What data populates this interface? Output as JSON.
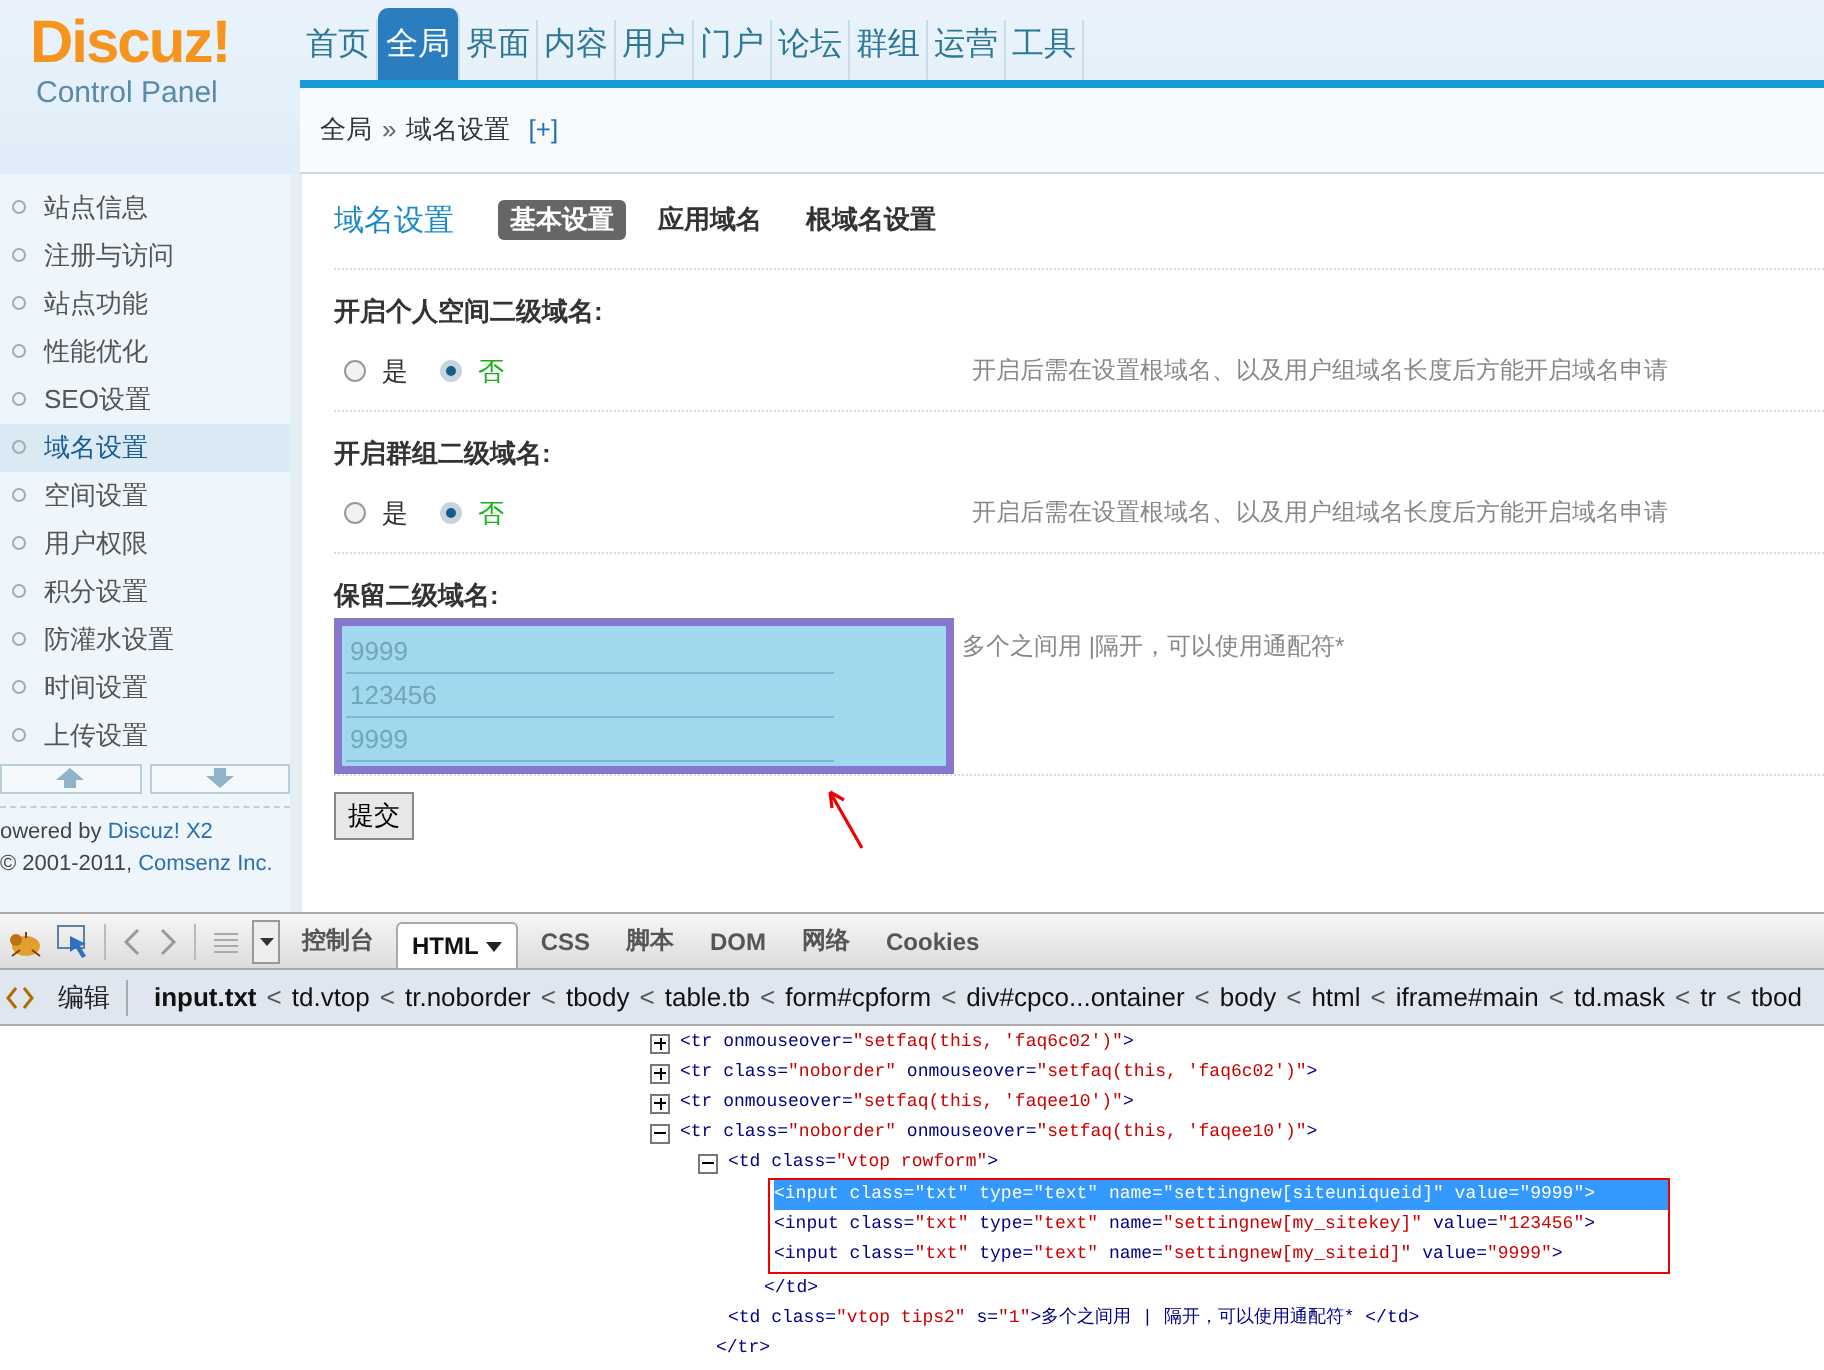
{
  "logo": {
    "title": "Discuz!",
    "subtitle": "Control Panel"
  },
  "nav": [
    {
      "label": "首页",
      "selected": false
    },
    {
      "label": "全局",
      "selected": true
    },
    {
      "label": "界面",
      "selected": false
    },
    {
      "label": "内容",
      "selected": false
    },
    {
      "label": "用户",
      "selected": false
    },
    {
      "label": "门户",
      "selected": false
    },
    {
      "label": "论坛",
      "selected": false
    },
    {
      "label": "群组",
      "selected": false
    },
    {
      "label": "运营",
      "selected": false
    },
    {
      "label": "工具",
      "selected": false
    }
  ],
  "breadcrumb": {
    "items": [
      "全局",
      "域名设置"
    ],
    "separator": "»",
    "add": "[+]"
  },
  "sidebar": {
    "items": [
      {
        "label": "站点信息",
        "selected": false
      },
      {
        "label": "注册与访问",
        "selected": false
      },
      {
        "label": "站点功能",
        "selected": false
      },
      {
        "label": "性能优化",
        "selected": false
      },
      {
        "label": "SEO设置",
        "selected": false
      },
      {
        "label": "域名设置",
        "selected": true
      },
      {
        "label": "空间设置",
        "selected": false
      },
      {
        "label": "用户权限",
        "selected": false
      },
      {
        "label": "积分设置",
        "selected": false
      },
      {
        "label": "防灌水设置",
        "selected": false
      },
      {
        "label": "时间设置",
        "selected": false
      },
      {
        "label": "上传设置",
        "selected": false
      }
    ],
    "powered": {
      "text": "owered by",
      "link": "Discuz! X2"
    },
    "copyright": {
      "text": "© 2001-2011,",
      "link": "Comsenz Inc."
    }
  },
  "main": {
    "title": "域名设置",
    "tabs": [
      {
        "label": "基本设置",
        "selected": true
      },
      {
        "label": "应用域名",
        "selected": false
      },
      {
        "label": "根域名设置",
        "selected": false
      }
    ],
    "settings": [
      {
        "kind": "radio",
        "label": "开启个人空间二级域名:",
        "options": [
          {
            "label": "是",
            "selected": false
          },
          {
            "label": "否",
            "selected": true
          }
        ],
        "tip": "开启后需在设置根域名、以及用户组域名长度后方能开启域名申请"
      },
      {
        "kind": "radio",
        "label": "开启群组二级域名:",
        "options": [
          {
            "label": "是",
            "selected": false
          },
          {
            "label": "否",
            "selected": true
          }
        ],
        "tip": "开启后需在设置根域名、以及用户组域名长度后方能开启域名申请"
      },
      {
        "kind": "inputs",
        "label": "保留二级域名:",
        "values": [
          "9999",
          "123456",
          "9999"
        ],
        "tip": "多个之间用 |隔开，可以使用通配符*"
      }
    ],
    "submit": "提交"
  },
  "devtools": {
    "tabs": [
      {
        "label": "控制台",
        "selected": false
      },
      {
        "label": "HTML",
        "selected": true
      },
      {
        "label": "CSS",
        "selected": false
      },
      {
        "label": "脚本",
        "selected": false
      },
      {
        "label": "DOM",
        "selected": false
      },
      {
        "label": "网络",
        "selected": false
      },
      {
        "label": "Cookies",
        "selected": false
      }
    ],
    "edit": "编辑",
    "separator": "<",
    "path": [
      "input.txt",
      "td.vtop",
      "tr.noborder",
      "tbody",
      "table.tb",
      "form#cpform",
      "div#cpco...ontainer",
      "body",
      "html",
      "iframe#main",
      "td.mask",
      "tr",
      "tbod"
    ],
    "tree": [
      {
        "text": "<tr onmouseover=\"setfaq(this, 'faq6c02')\">",
        "expanded": false
      },
      {
        "text": "<tr class=\"noborder\" onmouseover=\"setfaq(this, 'faq6c02')\">",
        "expanded": false
      },
      {
        "text": "<tr onmouseover=\"setfaq(this, 'faqee10')\">",
        "expanded": false
      },
      {
        "text": "<tr class=\"noborder\" onmouseover=\"setfaq(this, 'faqee10')\">",
        "expanded": true,
        "close": "</tr>",
        "children": [
          {
            "text": "<td class=\"vtop rowform\">",
            "expanded": true,
            "close": "</td>",
            "children": [
              {
                "text": "<input class=\"txt\" type=\"text\" name=\"settingnew[siteuniqueid]\" value=\"9999\">",
                "selected": true
              },
              {
                "text": "<input class=\"txt\" type=\"text\" name=\"settingnew[my_sitekey]\" value=\"123456\">",
                "selected": false
              },
              {
                "text": "<input class=\"txt\" type=\"text\" name=\"settingnew[my_siteid]\" value=\"9999\">",
                "selected": false
              }
            ]
          },
          {
            "text": "<td class=\"vtop tips2\" s=\"1\">多个之间用 | 隔开，可以使用通配符* </td>"
          }
        ]
      }
    ]
  }
}
